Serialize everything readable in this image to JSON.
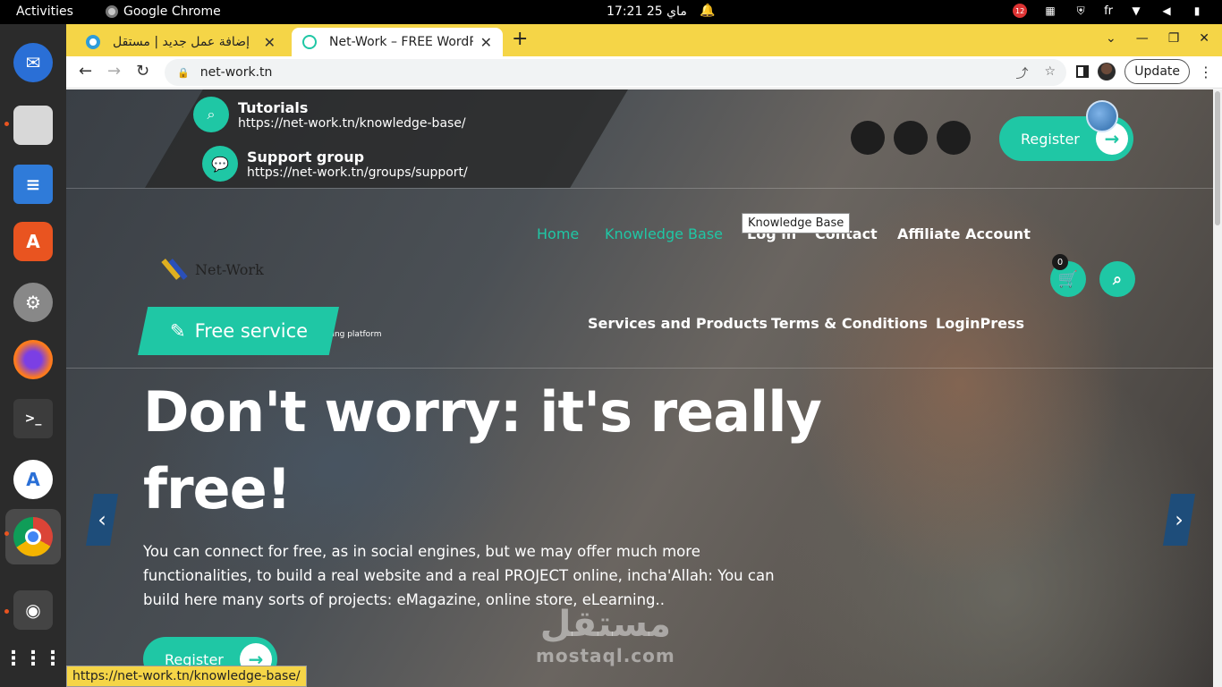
{
  "system": {
    "activities": "Activities",
    "app_name": "Google Chrome",
    "clock": "ماي 25  17:21",
    "language": "fr",
    "notification_badge": "12"
  },
  "browser": {
    "tabs": [
      {
        "title": "إضافة عمل جديد | مستقل",
        "active": false
      },
      {
        "title": "Net-Work – FREE WordPress",
        "active": true
      }
    ],
    "url": "net-work.tn",
    "update_label": "Update",
    "status_url": "https://net-work.tn/knowledge-base/"
  },
  "page": {
    "contact": [
      {
        "title": "Tutorials",
        "url": "https://net-work.tn/knowledge-base/",
        "icon": "search-icon"
      },
      {
        "title": "Support group",
        "url": "https://net-work.tn/groups/support/",
        "icon": "chat-icon"
      }
    ],
    "register_label": "Register",
    "nav_top": [
      "Home",
      "Knowledge Base",
      "Log in",
      "Contact",
      "Affiliate Account"
    ],
    "nav_bottom": [
      "Services and Products",
      "Terms & Conditions",
      "LoginPress"
    ],
    "tooltip": "Knowledge Base",
    "logo_text": "Net-Work",
    "tagline": "FREE Wordpress Hosting, Professional Networking platform",
    "free_service": "Free service",
    "cart_count": "0",
    "headline": "Don't worry: it's really free!",
    "lead": "You can connect for free, as in social engines, but we may offer much more functionalities, to build a real website and a real PROJECT online, incha'Allah: You can build here many sorts of projects: eMagazine, online store, eLearning..",
    "watermark_ar": "مستقل",
    "watermark_en": "mostaql.com",
    "accent_color": "#1fc7a5"
  }
}
